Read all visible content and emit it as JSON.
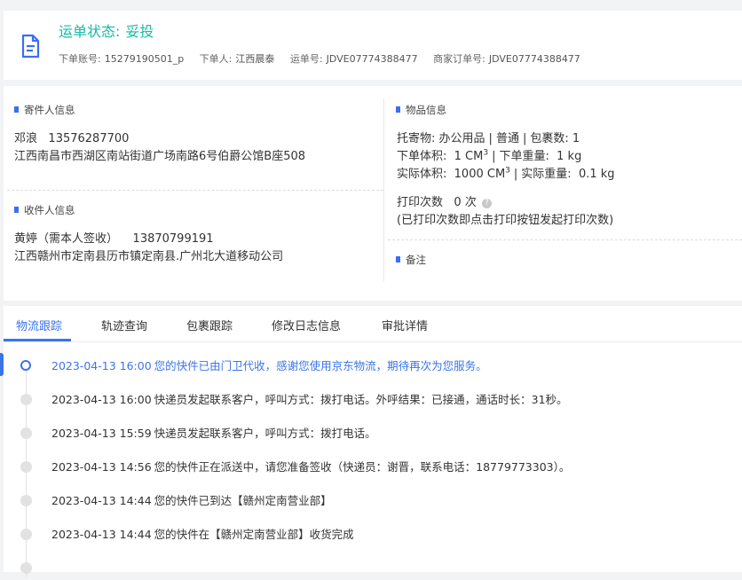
{
  "header": {
    "status_label": "运单状态:",
    "status_value": "妥投",
    "meta": [
      {
        "label": "下单账号:",
        "value": "15279190501_p"
      },
      {
        "label": "下单人:",
        "value": "江西晨泰"
      },
      {
        "label": "运单号:",
        "value": "JDVE07774388477"
      },
      {
        "label": "商家订单号:",
        "value": "JDVE07774388477"
      }
    ]
  },
  "sender": {
    "title": "寄件人信息",
    "name": "邓浪",
    "phone": "13576287700",
    "address": "江西南昌市西湖区南站街道广场南路6号伯爵公馆B座508"
  },
  "receiver": {
    "title": "收件人信息",
    "name": "黄婷（需本人签收）",
    "phone": "13870799191",
    "address": "江西赣州市定南县历市镇定南县.广州北大道移动公司"
  },
  "goods": {
    "title": "物品信息",
    "line1": {
      "cargo_label": "托寄物:",
      "cargo_value": "办公用品",
      "type": "普通",
      "pkg_label": "包裹数:",
      "pkg_value": "1"
    },
    "line2": {
      "vol_label": "下单体积:",
      "vol_value": "1 CM",
      "vol_sup": "3",
      "wt_label": "下单重量:",
      "wt_value": "1 kg"
    },
    "line3": {
      "vol_label": "实际体积:",
      "vol_value": "1000 CM",
      "vol_sup": "3",
      "wt_label": "实际重量:",
      "wt_value": "0.1 kg"
    },
    "print_label": "打印次数",
    "print_value": "0 次",
    "print_hint": "(已打印次数即点击打印按钮发起打印次数)"
  },
  "remark": {
    "title": "备注"
  },
  "tabs": [
    "物流跟踪",
    "轨迹查询",
    "包裹跟踪",
    "修改日志信息",
    "审批详情"
  ],
  "timeline": [
    {
      "time": "2023-04-13 16:00",
      "text": "您的快件已由门卫代收，感谢您使用京东物流，期待再次为您服务。"
    },
    {
      "time": "2023-04-13 16:00",
      "text": "快递员发起联系客户，呼叫方式：拨打电话。外呼结果：已接通，通话时长：31秒。"
    },
    {
      "time": "2023-04-13 15:59",
      "text": "快递员发起联系客户，呼叫方式：拨打电话。"
    },
    {
      "time": "2023-04-13 14:56",
      "text": "您的快件正在派送中，请您准备签收（快递员：谢晋，联系电话：18779773303）。"
    },
    {
      "time": "2023-04-13 14:44",
      "text": "您的快件已到达【赣州定南营业部】"
    },
    {
      "time": "2023-04-13 14:44",
      "text": "您的快件在【赣州定南营业部】收货完成"
    }
  ],
  "colors": {
    "accent": "#3b74e8",
    "status": "#18b9a4"
  }
}
